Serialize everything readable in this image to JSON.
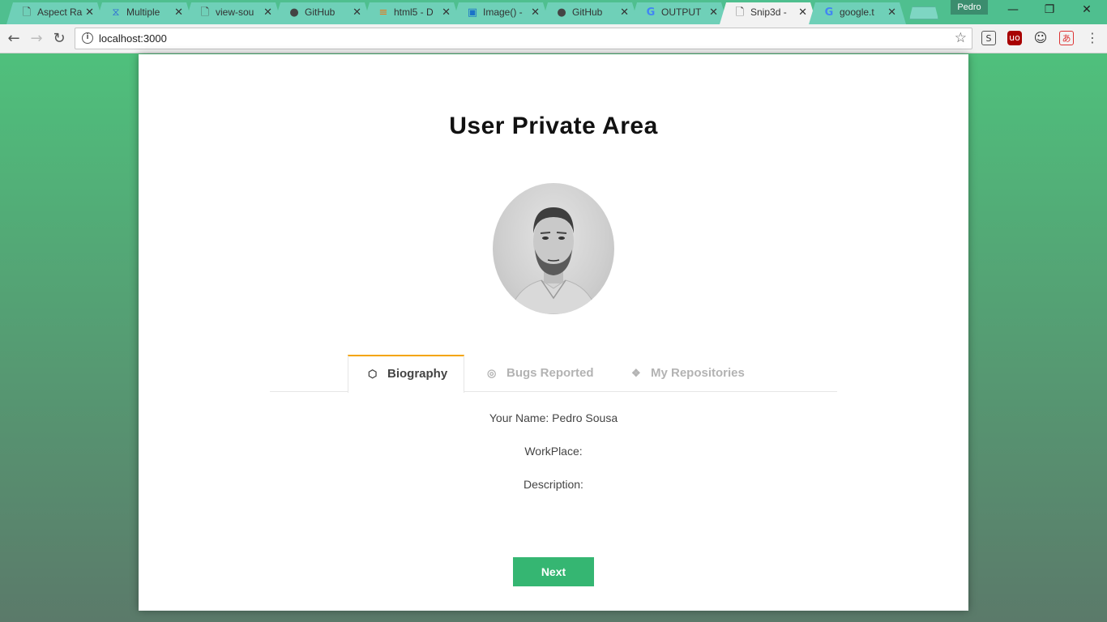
{
  "browser": {
    "tabs": [
      {
        "icon": "page-icon",
        "title": "Aspect Ra"
      },
      {
        "icon": "wp-icon",
        "title": "Multiple"
      },
      {
        "icon": "page-icon",
        "title": "view-sou"
      },
      {
        "icon": "github-icon",
        "title": "GitHub"
      },
      {
        "icon": "stack-icon",
        "title": "html5 - D"
      },
      {
        "icon": "image-icon",
        "title": "Image() -"
      },
      {
        "icon": "github-icon",
        "title": "GitHub"
      },
      {
        "icon": "google-icon",
        "title": "OUTPUT"
      },
      {
        "icon": "page-icon",
        "title": "Snip3d -"
      },
      {
        "icon": "google-icon",
        "title": "google.t"
      }
    ],
    "active_tab": 8,
    "profile_name": "Pedro",
    "url": "localhost:3000"
  },
  "page": {
    "title": "User Private Area",
    "tabs": [
      {
        "icon": "codepen-icon",
        "label": "Biography",
        "active": true
      },
      {
        "icon": "dribbble-icon",
        "label": "Bugs Reported",
        "active": false
      },
      {
        "icon": "dropbox-icon",
        "label": "My Repositories",
        "active": false
      }
    ],
    "fields": [
      {
        "label": "Your Name:",
        "value": "Pedro Sousa"
      },
      {
        "label": "WorkPlace:",
        "value": ""
      },
      {
        "label": "Description:",
        "value": ""
      }
    ],
    "next_label": "Next"
  },
  "colors": {
    "accent_tab": "#f4a400",
    "button": "#35b672",
    "background_top": "#4fc07c",
    "background_bottom": "#5b7a6a"
  }
}
